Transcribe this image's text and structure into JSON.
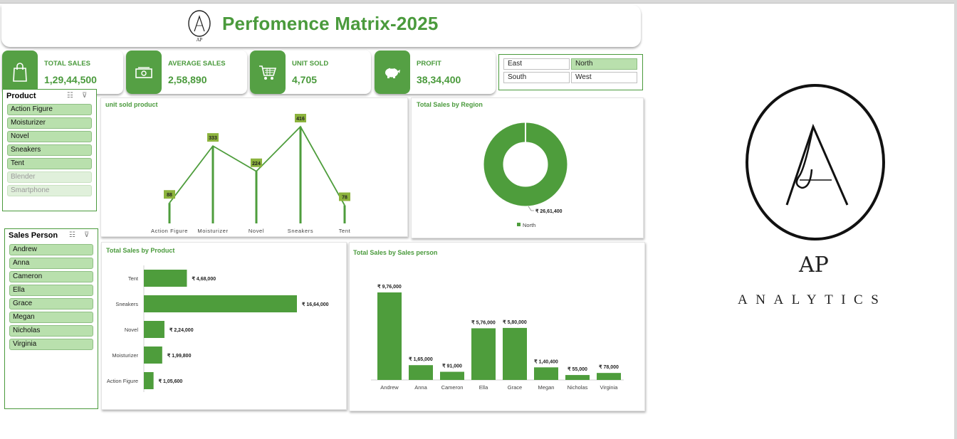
{
  "header": {
    "title": "Perfomence Matrix-2025",
    "logo_caption": "ANALYTICS"
  },
  "kpis": [
    {
      "label": "TOTAL SALES",
      "value": "1,29,44,500",
      "icon": "shopping-bag-icon"
    },
    {
      "label": "AVERAGE  SALES",
      "value": "2,58,890",
      "icon": "cash-icon"
    },
    {
      "label": "UNIT SOLD",
      "value": "4,705",
      "icon": "shopping-cart-icon"
    },
    {
      "label": "PROFIT",
      "value": "38,34,400",
      "icon": "piggy-bank-icon"
    }
  ],
  "region_slicer": {
    "items": [
      {
        "label": "East",
        "selected": false
      },
      {
        "label": "North",
        "selected": true
      },
      {
        "label": "South",
        "selected": false
      },
      {
        "label": "West",
        "selected": false
      }
    ]
  },
  "product_slicer": {
    "title": "Product",
    "items": [
      {
        "label": "Action Figure",
        "available": true
      },
      {
        "label": "Moisturizer",
        "available": true
      },
      {
        "label": "Novel",
        "available": true
      },
      {
        "label": "Sneakers",
        "available": true
      },
      {
        "label": "Tent",
        "available": true
      },
      {
        "label": "Blender",
        "available": false
      },
      {
        "label": "Smartphone",
        "available": false
      }
    ]
  },
  "salesperson_slicer": {
    "title": "Sales Person",
    "items": [
      "Andrew",
      "Anna",
      "Cameron",
      "Ella",
      "Grace",
      "Megan",
      "Nicholas",
      "Virginia"
    ]
  },
  "colors": {
    "accent": "#4a9a3c",
    "bar": "#4e9d3c",
    "label_bg": "#8cb33d",
    "selected": "#b9e0ad"
  },
  "brand": {
    "monogram": "AP",
    "name": "ANALYTICS"
  },
  "chart_data": [
    {
      "type": "line",
      "title": "unit sold  product",
      "categories": [
        "Action Figure",
        "Moisturizer",
        "Novel",
        "Sneakers",
        "Tent"
      ],
      "values": [
        88,
        333,
        224,
        416,
        78
      ]
    },
    {
      "type": "pie",
      "title": "Total Sales by Region",
      "series": [
        {
          "name": "North",
          "values": [
            2661400
          ]
        }
      ],
      "labels": [
        "₹ 26,61,400"
      ],
      "legend": "bottom"
    },
    {
      "type": "bar",
      "orientation": "horizontal",
      "title": "Total Sales by Product",
      "categories": [
        "Tent",
        "Sneakers",
        "Novel",
        "Moisturizer",
        "Action Figure"
      ],
      "values": [
        468000,
        1664000,
        224000,
        199800,
        105600
      ],
      "labels": [
        "₹ 4,68,000",
        "₹ 16,64,000",
        "₹ 2,24,000",
        "₹ 1,99,800",
        "₹ 1,05,600"
      ]
    },
    {
      "type": "bar",
      "title": "Total Sales by Sales person",
      "categories": [
        "Andrew",
        "Anna",
        "Cameron",
        "Ella",
        "Grace",
        "Megan",
        "Nicholas",
        "Virginia"
      ],
      "values": [
        976000,
        165000,
        91000,
        576000,
        580000,
        140400,
        55000,
        78000
      ],
      "labels": [
        "₹ 9,76,000",
        "₹ 1,65,000",
        "₹ 91,000",
        "₹ 5,76,000",
        "₹ 5,80,000",
        "₹ 1,40,400",
        "₹ 55,000",
        "₹ 78,000"
      ]
    }
  ]
}
